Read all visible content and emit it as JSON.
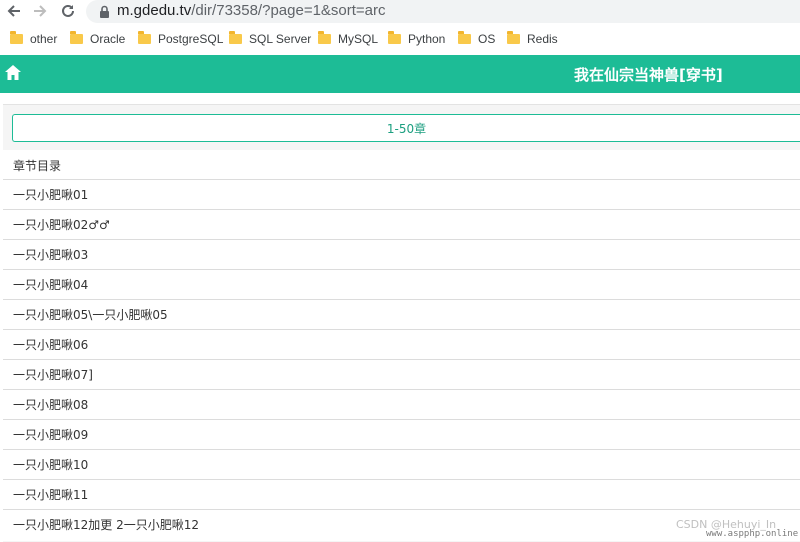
{
  "browser": {
    "url_domain": "m.gdedu.tv",
    "url_path": "/dir/73358/?page=1&sort=arc",
    "bookmarks": [
      "other",
      "Oracle",
      "PostgreSQL",
      "SQL Server",
      "MySQL",
      "Python",
      "OS",
      "Redis"
    ]
  },
  "header": {
    "title": "我在仙宗当神兽[穿书]",
    "home_icon": "home-icon",
    "color": "#1dbc96"
  },
  "range_button": {
    "label": "1-50章"
  },
  "chapter_list": {
    "heading": "章节目录",
    "chapters": [
      "一只小肥啾01",
      "一只小肥啾02♂♂",
      "一只小肥啾03",
      "一只小肥啾04",
      "一只小肥啾05\\一只小肥啾05",
      "一只小肥啾06",
      "一只小肥啾07]",
      "一只小肥啾08",
      "一只小肥啾09",
      "一只小肥啾10",
      "一只小肥啾11",
      "一只小肥啾12加更 2一只小肥啾12"
    ]
  },
  "watermark": {
    "text": "CSDN @Hehuyi_In",
    "stamp": "www.aspphp.online"
  }
}
